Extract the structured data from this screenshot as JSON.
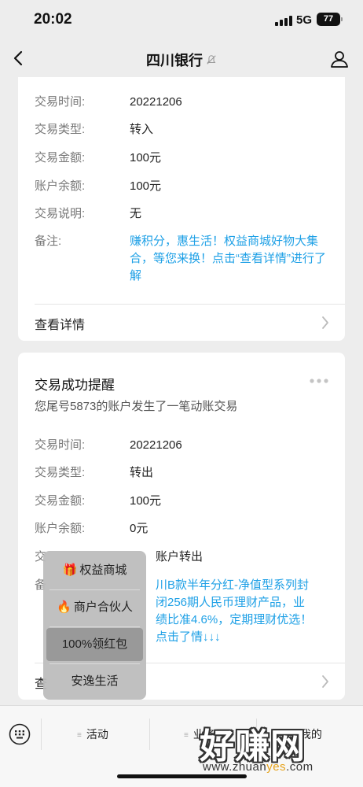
{
  "status_bar": {
    "time": "20:02",
    "network": "5G",
    "battery": "77"
  },
  "nav": {
    "title": "四川银行"
  },
  "card1": {
    "rows": [
      {
        "key": "交易时间:",
        "value": "20221206"
      },
      {
        "key": "交易类型:",
        "value": "转入"
      },
      {
        "key": "交易金额:",
        "value": "100元"
      },
      {
        "key": "账户余额:",
        "value": "100元"
      },
      {
        "key": "交易说明:",
        "value": "无"
      },
      {
        "key": "备注:",
        "value": "赚积分，惠生活！权益商城好物大集合，等您来换！点击“查看详情”进行了解"
      }
    ],
    "detail_label": "查看详情"
  },
  "card2": {
    "title": "交易成功提醒",
    "subtitle": "您尾号5873的账户发生了一笔动账交易",
    "rows": [
      {
        "key": "交易时间:",
        "value": "20221206"
      },
      {
        "key": "交易类型:",
        "value": "转出"
      },
      {
        "key": "交易金额:",
        "value": "100元"
      },
      {
        "key": "账户余额:",
        "value": "0元"
      },
      {
        "key": "交",
        "value": "账户转出"
      },
      {
        "key": "备",
        "value": "川B款半年分红-净值型系列封闭256期人民币理财产品，业绩比准4.6%，定期理财优选！点击了情↓↓↓"
      }
    ],
    "detail_label": "查"
  },
  "popup_menu": {
    "items": [
      {
        "emoji": "🎁",
        "label": "权益商城"
      },
      {
        "emoji": "🔥",
        "label": "商户合伙人"
      },
      {
        "emoji": "",
        "label": "100%领红包"
      },
      {
        "emoji": "",
        "label": "安逸生活"
      }
    ]
  },
  "bottom_menu": {
    "items": [
      {
        "label": "活动"
      },
      {
        "label": "业务"
      },
      {
        "label": "我的"
      }
    ]
  },
  "watermark": {
    "text": "好赚网",
    "url_prefix": "www.zhuan",
    "url_highlight": "yes",
    "url_suffix": ".com"
  },
  "colors": {
    "link": "#1ea0e6",
    "background": "#ededed",
    "card": "#ffffff"
  }
}
